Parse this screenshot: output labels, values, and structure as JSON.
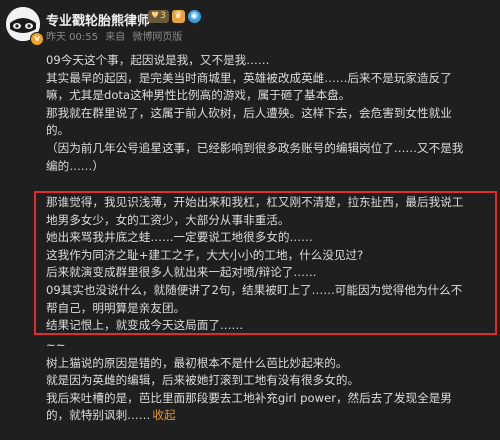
{
  "header": {
    "username": "专业戳轮胎熊律师",
    "fan_badge": "3",
    "meta_time": "昨天 00:55",
    "meta_from": "来自",
    "meta_source": "微博网页版"
  },
  "colors": {
    "background": "#1f1f1f",
    "text": "#dcdcdc",
    "highlight_border": "#e22b2b",
    "collapse_link": "#e8962a"
  },
  "icons": {
    "avatar": "panda-avatar-icon",
    "verified": "v-verified-icon",
    "fan_badge": "fan-badge-icon",
    "level": "level-icon",
    "globe": "globe-icon"
  },
  "body": {
    "before": [
      "09今天这个事，起因说是我，又不是我……",
      "其实最早的起因，是完美当时商城里，英雄被改成英雌……后来不是玩家造反了",
      "嘛，尤其是dota这种男性比例高的游戏，属于砸了基本盘。",
      "那我就在群里说了，这属于前人砍树，后人遭殃。这样下去，会危害到女性就业",
      "的。",
      "（因为前几年公号追星这事，已经影响到很多政务账号的编辑岗位了……又不是我",
      "编的……）"
    ],
    "highlighted": [
      "那谁觉得，我见识浅薄，开始出来和我杠，杠又刚不清楚，拉东扯西，最后我说工",
      "地男多女少，女的工资少，大部分从事非重活。",
      "她出来骂我井底之蛙……一定要说工地很多女的……",
      "这我作为同济之耻+建工之子，大大小小的工地，什么没见过?",
      "后来就演变成群里很多人就出来一起对喷/辩论了……",
      "09其实也没说什么，就随便讲了2句，结果被盯上了……可能因为觉得他为什么不",
      "帮自己，明明算是亲友团。",
      "结果记恨上，就变成今天这局面了……"
    ],
    "after": [
      "~~",
      "树上猫说的原因是错的，最初根本不是什么芭比妙起来的。",
      "就是因为英雌的编辑，后来被她打滚到工地有没有很多女的。",
      "我后来吐槽的是，芭比里面那段要去工地补充girl power，然后去了发现全是男",
      "的，就特别讽刺……"
    ],
    "collapse_label": "收起"
  }
}
